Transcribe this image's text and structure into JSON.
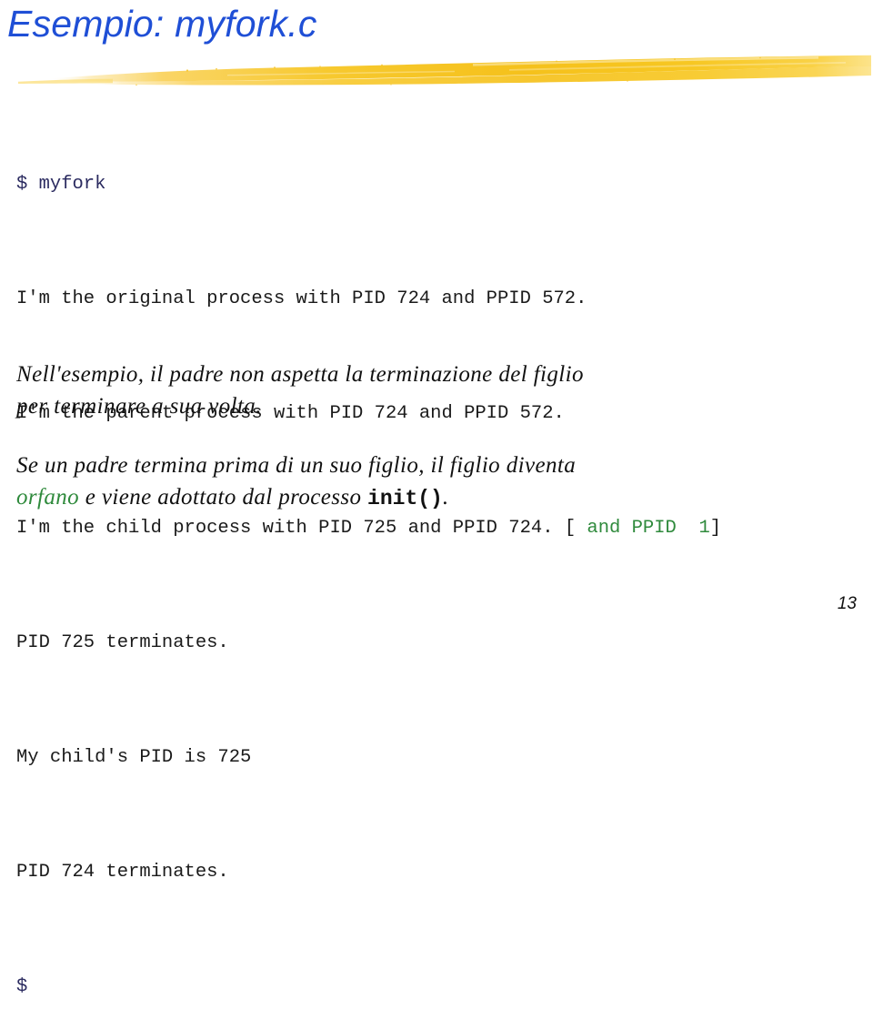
{
  "slide": {
    "title": "Esempio: myfork.c",
    "page_number": "13",
    "title_color": "#1f4fd6",
    "accent_brush_color": "#f5c323",
    "highlight_green": "#2f8a3c",
    "prompt_color": "#2b2b60"
  },
  "terminal": {
    "prompt_line": "$ myfork",
    "lines": [
      "I'm the original process with PID 724 and PPID 572.",
      "I'm the parent process with PID 724 and PPID 572."
    ],
    "child_line": {
      "text": "I'm the child process with PID 725 and PPID 724. ",
      "bracket_open": "[",
      "annotation": " and PPID  1",
      "bracket_close": "]"
    },
    "lines_after": [
      "PID 725 terminates.",
      "My child's PID is 725",
      "PID 724 terminates."
    ],
    "final_prompt": "$"
  },
  "body": {
    "paragraph1_line1": "Nell'esempio, il padre non aspetta la terminazione del figlio",
    "paragraph1_line2": "per terminare a sua volta.",
    "paragraph2_line1": "Se un padre termina prima di un suo figlio, il figlio diventa",
    "paragraph2_part1": "orfano",
    "paragraph2_part2": " e viene adottato dal processo ",
    "paragraph2_code": "init()",
    "paragraph2_part3": "."
  }
}
